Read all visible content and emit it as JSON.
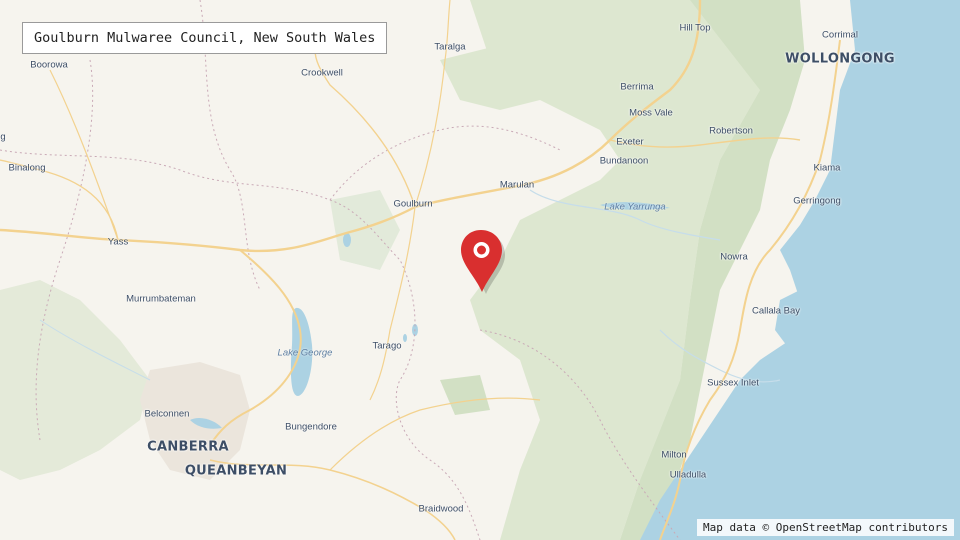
{
  "title": "Goulburn Mulwaree Council, New South Wales",
  "attribution": "Map data © OpenStreetMap contributors",
  "marker": {
    "icon": "location-pin-icon",
    "color": "#d92f2f"
  },
  "places": {
    "hill_top": "Hill Top",
    "corrimal": "Corrimal",
    "wollongong": "WOLLONGONG",
    "taralga": "Taralga",
    "boorowa": "Boorowa",
    "crookwell": "Crookwell",
    "berrima": "Berrima",
    "moss_vale": "Moss Vale",
    "robertson": "Robertson",
    "exeter": "Exeter",
    "bundanoon": "Bundanoon",
    "kiama": "Kiama",
    "binalong": "Binalong",
    "marulan": "Marulan",
    "goulburn": "Goulburn",
    "gerringong": "Gerringong",
    "yass": "Yass",
    "nowra": "Nowra",
    "murrumbateman": "Murrumbateman",
    "callala_bay": "Callala Bay",
    "tarago": "Tarago",
    "sussex_inlet": "Sussex Inlet",
    "belconnen": "Belconnen",
    "bungendore": "Bungendore",
    "canberra": "CANBERRA",
    "queanbeyan": "QUEANBEYAN",
    "milton": "Milton",
    "ulladulla": "Ulladulla",
    "braidwood": "Braidwood",
    "cut_g": "g"
  },
  "lakes": {
    "lake_yarrunga": "Lake Yarrunga",
    "lake_george": "Lake George"
  },
  "colors": {
    "land": "#f6f4ee",
    "forest": "#dbe6cf",
    "water": "#acd2e3",
    "road": "#f5d79a",
    "urban": "#e6e0d8"
  }
}
